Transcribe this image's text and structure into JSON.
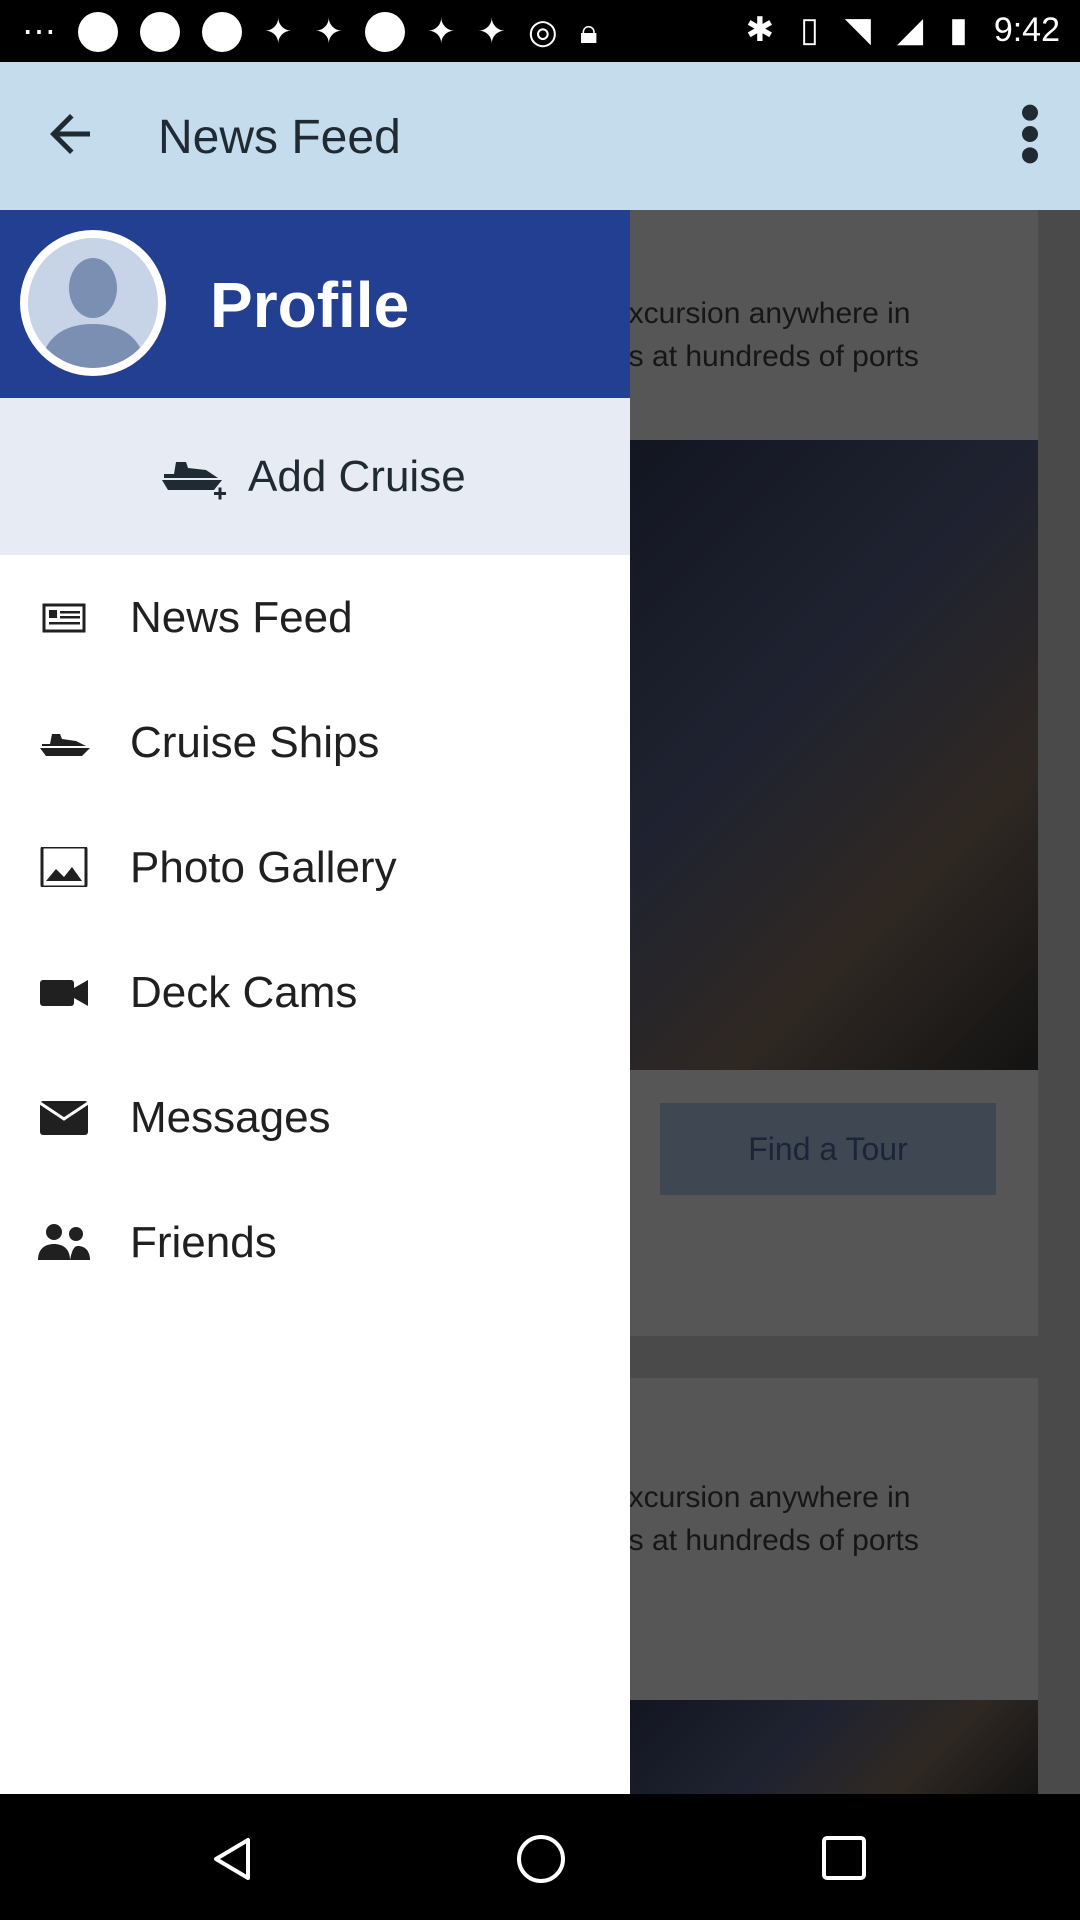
{
  "status_bar": {
    "time": "9:42"
  },
  "app_bar": {
    "title": "News Feed"
  },
  "drawer": {
    "profile_name": "Profile",
    "add_cruise_label": "Add Cruise",
    "items": [
      {
        "label": "News Feed",
        "icon": "news-icon"
      },
      {
        "label": "Cruise Ships",
        "icon": "ship-icon"
      },
      {
        "label": "Photo Gallery",
        "icon": "image-icon"
      },
      {
        "label": "Deck Cams",
        "icon": "videocam-icon"
      },
      {
        "label": "Messages",
        "icon": "mail-icon"
      },
      {
        "label": "Friends",
        "icon": "people-icon"
      }
    ]
  },
  "background": {
    "card1_line1": "excursion anywhere in",
    "card1_line2": "es at hundreds of ports",
    "find_tour_label": "Find a Tour",
    "card2_line1": "excursion anywhere in",
    "card2_line2": "es at hundreds of ports"
  },
  "colors": {
    "app_bar": "#c5dcec",
    "drawer_header": "#233f92",
    "add_cruise_bg": "#e7ebf4"
  }
}
